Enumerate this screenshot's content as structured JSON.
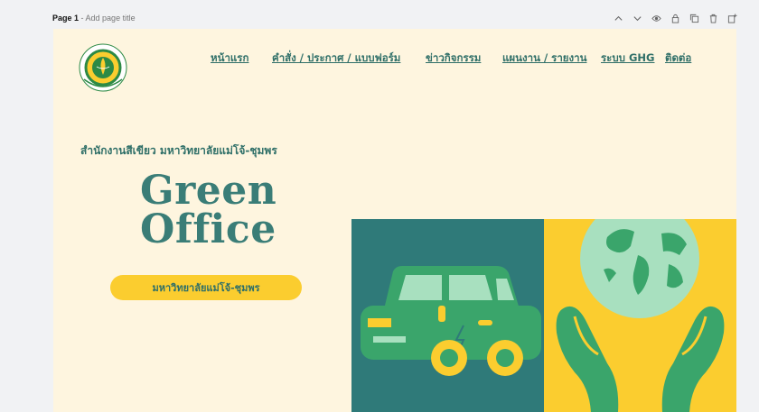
{
  "editor": {
    "page_label": "Page 1",
    "page_title_placeholder": " - Add page title",
    "tools": [
      "chevron-up-icon",
      "chevron-down-icon",
      "eye-icon",
      "lock-icon",
      "duplicate-icon",
      "trash-icon",
      "add-page-icon"
    ]
  },
  "site": {
    "nav": [
      "หน้าแรก",
      "คำสั่ง / ประกาศ / แบบฟอร์ม",
      "ข่าวกิจกรรม",
      "แผนงาน / รายงาน",
      "ระบบ GHG",
      "ติดต่อ"
    ],
    "subtitle": "สำนักงานสีเขียว มหาวิทยาลัยแม่โจ้-ชุมพร",
    "hero_line1": "Green",
    "hero_line2": "Office",
    "pill_button": "มหาวิทยาลัยแม่โจ้-ชุมพร"
  },
  "colors": {
    "canvas_bg": "#fef5df",
    "teal": "#2f7a79",
    "yellow": "#fbcd2f",
    "green": "#3aa56b",
    "light_green": "#a8e0bf"
  }
}
